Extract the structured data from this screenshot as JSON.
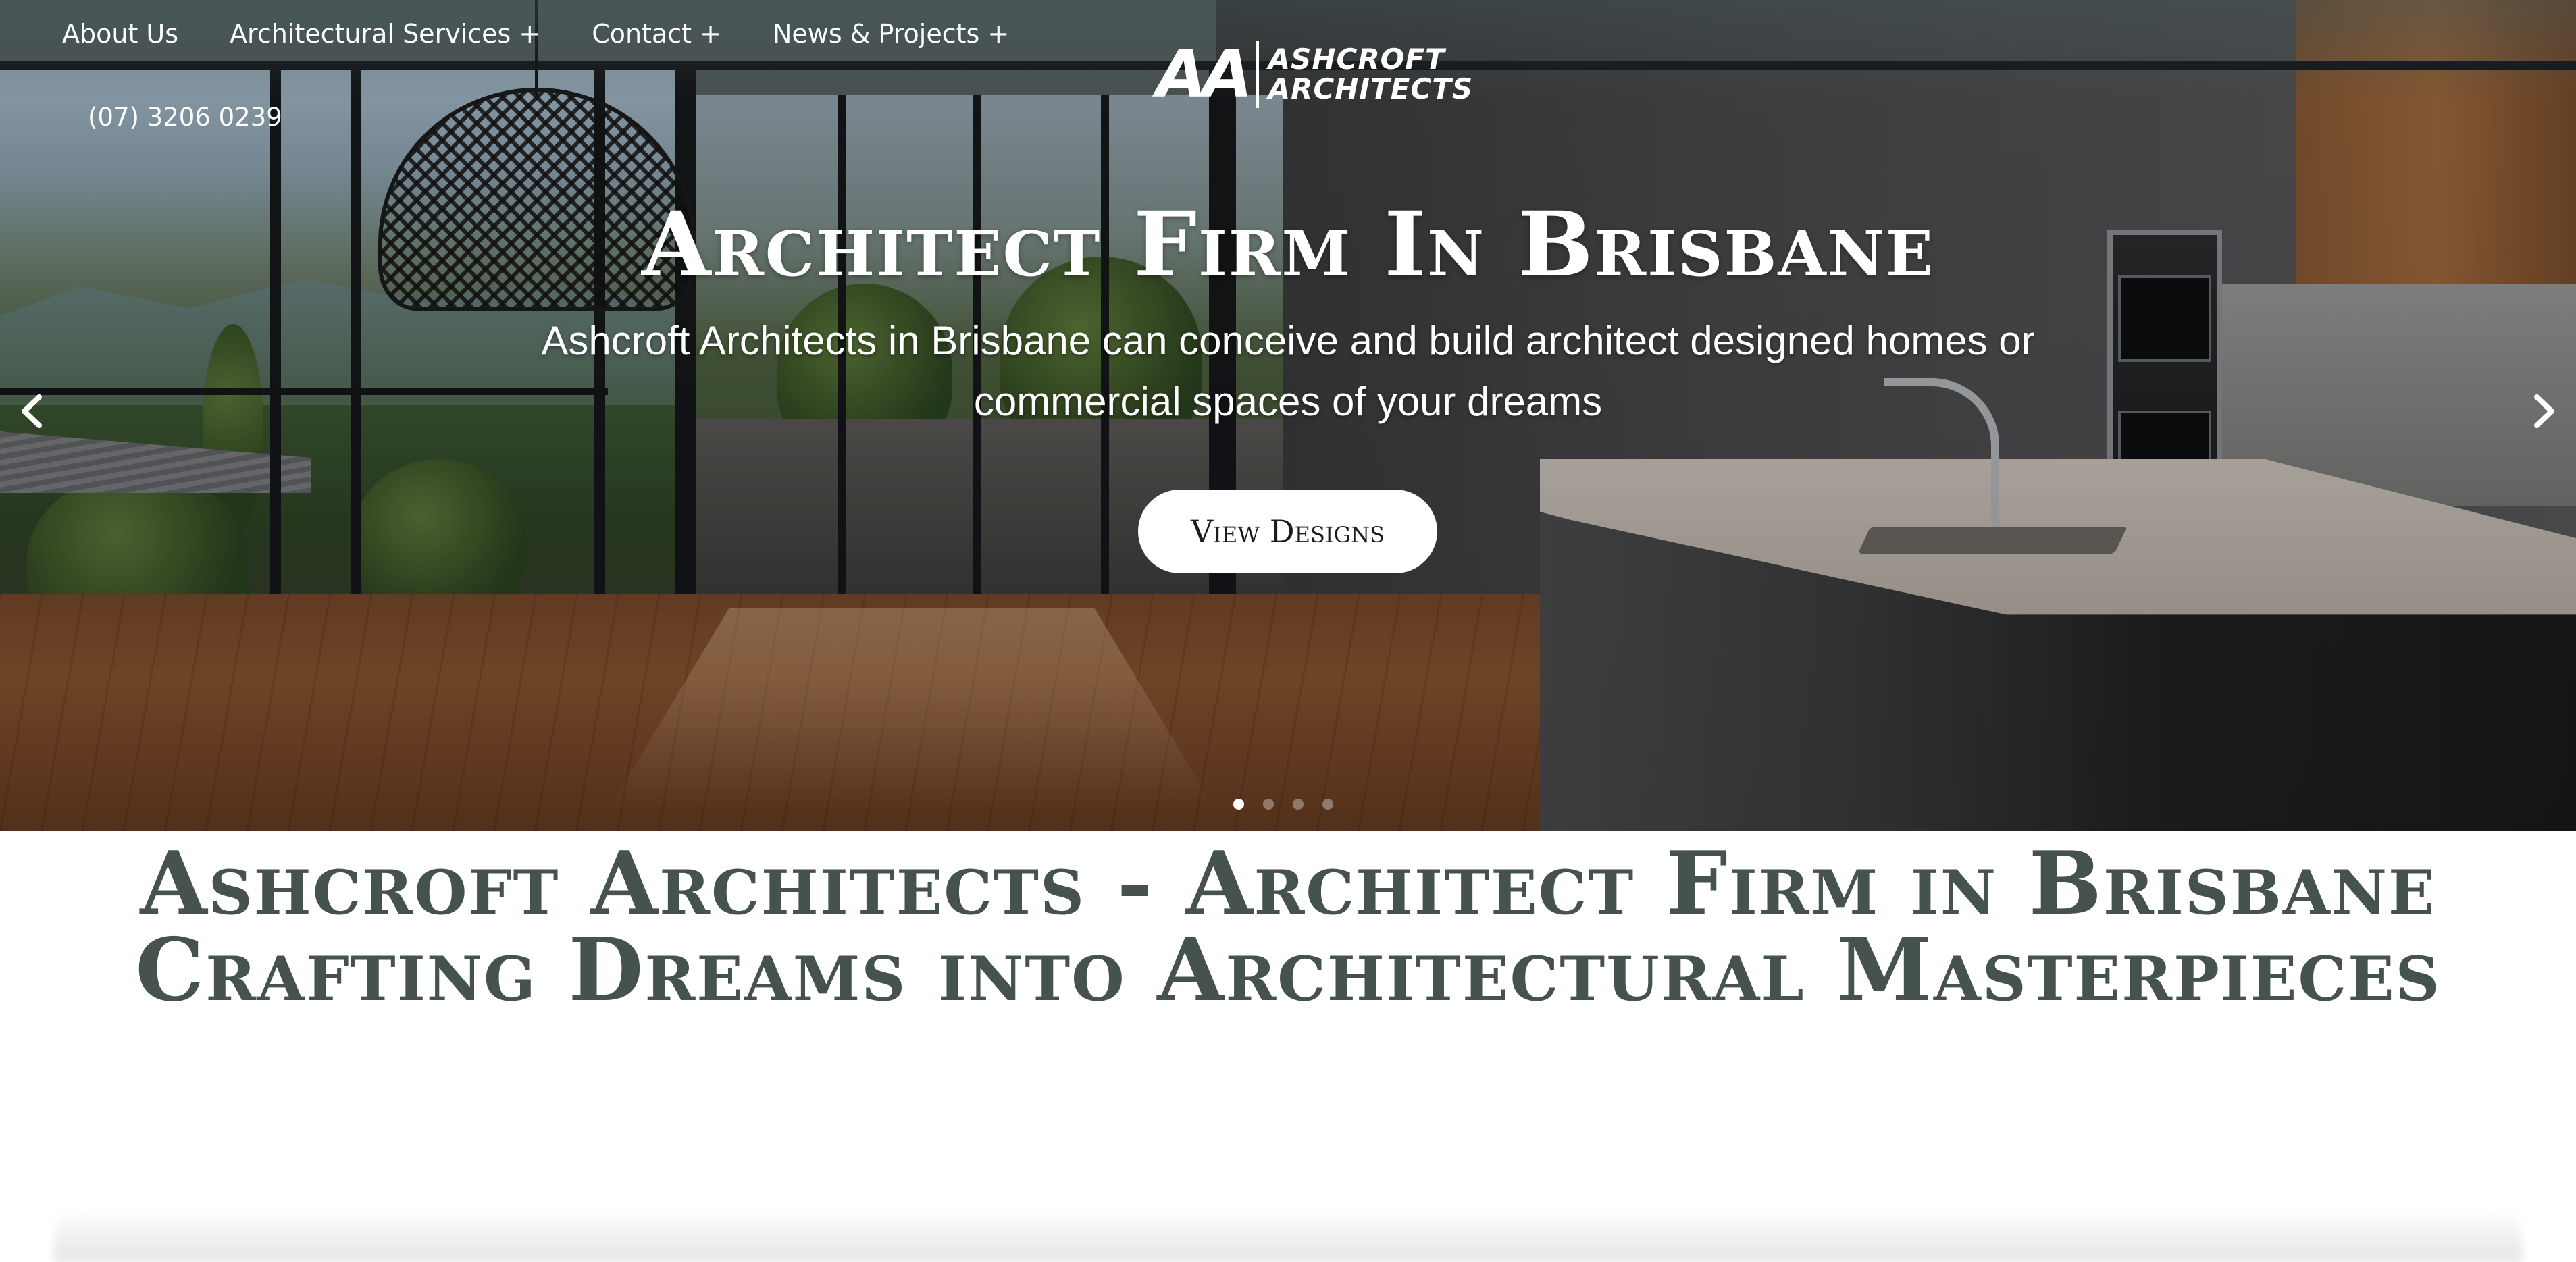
{
  "nav": {
    "items": [
      {
        "label": "About Us"
      },
      {
        "label": "Architectural Services +"
      },
      {
        "label": "Contact +"
      },
      {
        "label": "News & Projects +"
      }
    ],
    "phone": "(07) 3206 0239"
  },
  "logo": {
    "mark": "AA",
    "line1": "ASHCROFT",
    "line2": "ARCHITECTS"
  },
  "hero": {
    "title": "Architect Firm In Brisbane",
    "subtitle": "Ashcroft Architects in Brisbane can conceive and build architect designed homes or commercial spaces of your dreams",
    "cta_label": "View Designs",
    "slides_total": 4,
    "active_slide": 1,
    "prev_icon": "chevron-left-icon",
    "next_icon": "chevron-right-icon"
  },
  "section": {
    "heading": "Ashcroft Architects - Architect Firm in Brisbane Crafting Dreams into Architectural Masterpieces"
  },
  "colors": {
    "heading": "#46524f",
    "button_bg": "#ffffff",
    "nav_text": "#ffffff"
  }
}
